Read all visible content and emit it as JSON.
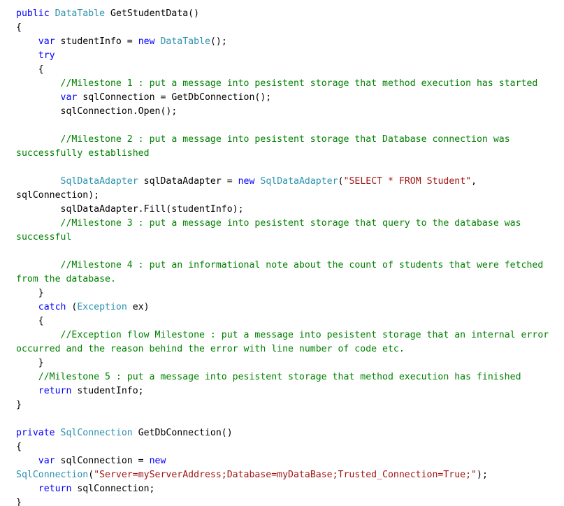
{
  "editor": {
    "language": "csharp",
    "background_color": "#FFFFFF",
    "wrap_enabled": true,
    "colors": {
      "plain": "#000000",
      "keyword": "#0000FF",
      "type": "#2B91AF",
      "comment": "#008000",
      "string": "#A31515"
    }
  },
  "code": {
    "lines": [
      {
        "tokens": [
          {
            "t": "keyword",
            "s": "public"
          },
          {
            "t": "plain",
            "s": " "
          },
          {
            "t": "type",
            "s": "DataTable"
          },
          {
            "t": "plain",
            "s": " GetStudentData()"
          }
        ]
      },
      {
        "tokens": [
          {
            "t": "plain",
            "s": "{"
          }
        ]
      },
      {
        "tokens": [
          {
            "t": "plain",
            "s": "    "
          },
          {
            "t": "keyword",
            "s": "var"
          },
          {
            "t": "plain",
            "s": " studentInfo = "
          },
          {
            "t": "keyword",
            "s": "new"
          },
          {
            "t": "plain",
            "s": " "
          },
          {
            "t": "type",
            "s": "DataTable"
          },
          {
            "t": "plain",
            "s": "();"
          }
        ]
      },
      {
        "tokens": [
          {
            "t": "plain",
            "s": "    "
          },
          {
            "t": "keyword",
            "s": "try"
          }
        ]
      },
      {
        "tokens": [
          {
            "t": "plain",
            "s": "    {"
          }
        ]
      },
      {
        "tokens": [
          {
            "t": "plain",
            "s": "        "
          },
          {
            "t": "comment",
            "s": "//Milestone 1 : put a message into pesistent storage that method execution has started"
          }
        ]
      },
      {
        "tokens": [
          {
            "t": "plain",
            "s": "        "
          },
          {
            "t": "keyword",
            "s": "var"
          },
          {
            "t": "plain",
            "s": " sqlConnection = GetDbConnection();"
          }
        ]
      },
      {
        "tokens": [
          {
            "t": "plain",
            "s": "        sqlConnection.Open();"
          }
        ]
      },
      {
        "tokens": [
          {
            "t": "plain",
            "s": ""
          }
        ]
      },
      {
        "tokens": [
          {
            "t": "plain",
            "s": "        "
          },
          {
            "t": "comment",
            "s": "//Milestone 2 : put a message into pesistent storage that Database connection was successfully established"
          }
        ]
      },
      {
        "tokens": [
          {
            "t": "plain",
            "s": ""
          }
        ]
      },
      {
        "tokens": [
          {
            "t": "plain",
            "s": "        "
          },
          {
            "t": "type",
            "s": "SqlDataAdapter"
          },
          {
            "t": "plain",
            "s": " sqlDataAdapter = "
          },
          {
            "t": "keyword",
            "s": "new"
          },
          {
            "t": "plain",
            "s": " "
          },
          {
            "t": "type",
            "s": "SqlDataAdapter"
          },
          {
            "t": "plain",
            "s": "("
          },
          {
            "t": "string",
            "s": "\"SELECT * FROM Student\""
          },
          {
            "t": "plain",
            "s": ", sqlConnection);"
          }
        ]
      },
      {
        "tokens": [
          {
            "t": "plain",
            "s": "        sqlDataAdapter.Fill(studentInfo);"
          }
        ]
      },
      {
        "tokens": [
          {
            "t": "plain",
            "s": "        "
          },
          {
            "t": "comment",
            "s": "//Milestone 3 : put a message into pesistent storage that query to the database was successful"
          }
        ]
      },
      {
        "tokens": [
          {
            "t": "plain",
            "s": ""
          }
        ]
      },
      {
        "tokens": [
          {
            "t": "plain",
            "s": "        "
          },
          {
            "t": "comment",
            "s": "//Milestone 4 : put an informational note about the count of students that were fetched from the database."
          }
        ]
      },
      {
        "tokens": [
          {
            "t": "plain",
            "s": "    }"
          }
        ]
      },
      {
        "tokens": [
          {
            "t": "plain",
            "s": "    "
          },
          {
            "t": "keyword",
            "s": "catch"
          },
          {
            "t": "plain",
            "s": " ("
          },
          {
            "t": "type",
            "s": "Exception"
          },
          {
            "t": "plain",
            "s": " ex)"
          }
        ]
      },
      {
        "tokens": [
          {
            "t": "plain",
            "s": "    {"
          }
        ]
      },
      {
        "tokens": [
          {
            "t": "plain",
            "s": "        "
          },
          {
            "t": "comment",
            "s": "//Exception flow Milestone : put a message into pesistent storage that an internal error occurred and the reason behind the error with line number of code etc."
          }
        ]
      },
      {
        "tokens": [
          {
            "t": "plain",
            "s": "    }"
          }
        ]
      },
      {
        "tokens": [
          {
            "t": "plain",
            "s": "    "
          },
          {
            "t": "comment",
            "s": "//Milestone 5 : put a message into pesistent storage that method execution has finished"
          }
        ]
      },
      {
        "tokens": [
          {
            "t": "plain",
            "s": "    "
          },
          {
            "t": "keyword",
            "s": "return"
          },
          {
            "t": "plain",
            "s": " studentInfo;"
          }
        ]
      },
      {
        "tokens": [
          {
            "t": "plain",
            "s": "}"
          }
        ]
      },
      {
        "tokens": [
          {
            "t": "plain",
            "s": ""
          }
        ]
      },
      {
        "tokens": [
          {
            "t": "keyword",
            "s": "private"
          },
          {
            "t": "plain",
            "s": " "
          },
          {
            "t": "type",
            "s": "SqlConnection"
          },
          {
            "t": "plain",
            "s": " GetDbConnection()"
          }
        ]
      },
      {
        "tokens": [
          {
            "t": "plain",
            "s": "{"
          }
        ]
      },
      {
        "tokens": [
          {
            "t": "plain",
            "s": "    "
          },
          {
            "t": "keyword",
            "s": "var"
          },
          {
            "t": "plain",
            "s": " sqlConnection = "
          },
          {
            "t": "keyword",
            "s": "new"
          },
          {
            "t": "plain",
            "s": " "
          },
          {
            "t": "type",
            "s": "SqlConnection"
          },
          {
            "t": "plain",
            "s": "("
          },
          {
            "t": "string",
            "s": "\"Server=myServerAddress;Database=myDataBase;Trusted_Connection=True;\""
          },
          {
            "t": "plain",
            "s": ");"
          }
        ]
      },
      {
        "tokens": [
          {
            "t": "plain",
            "s": "    "
          },
          {
            "t": "keyword",
            "s": "return"
          },
          {
            "t": "plain",
            "s": " sqlConnection;"
          }
        ]
      },
      {
        "tokens": [
          {
            "t": "plain",
            "s": "}"
          }
        ]
      }
    ]
  }
}
